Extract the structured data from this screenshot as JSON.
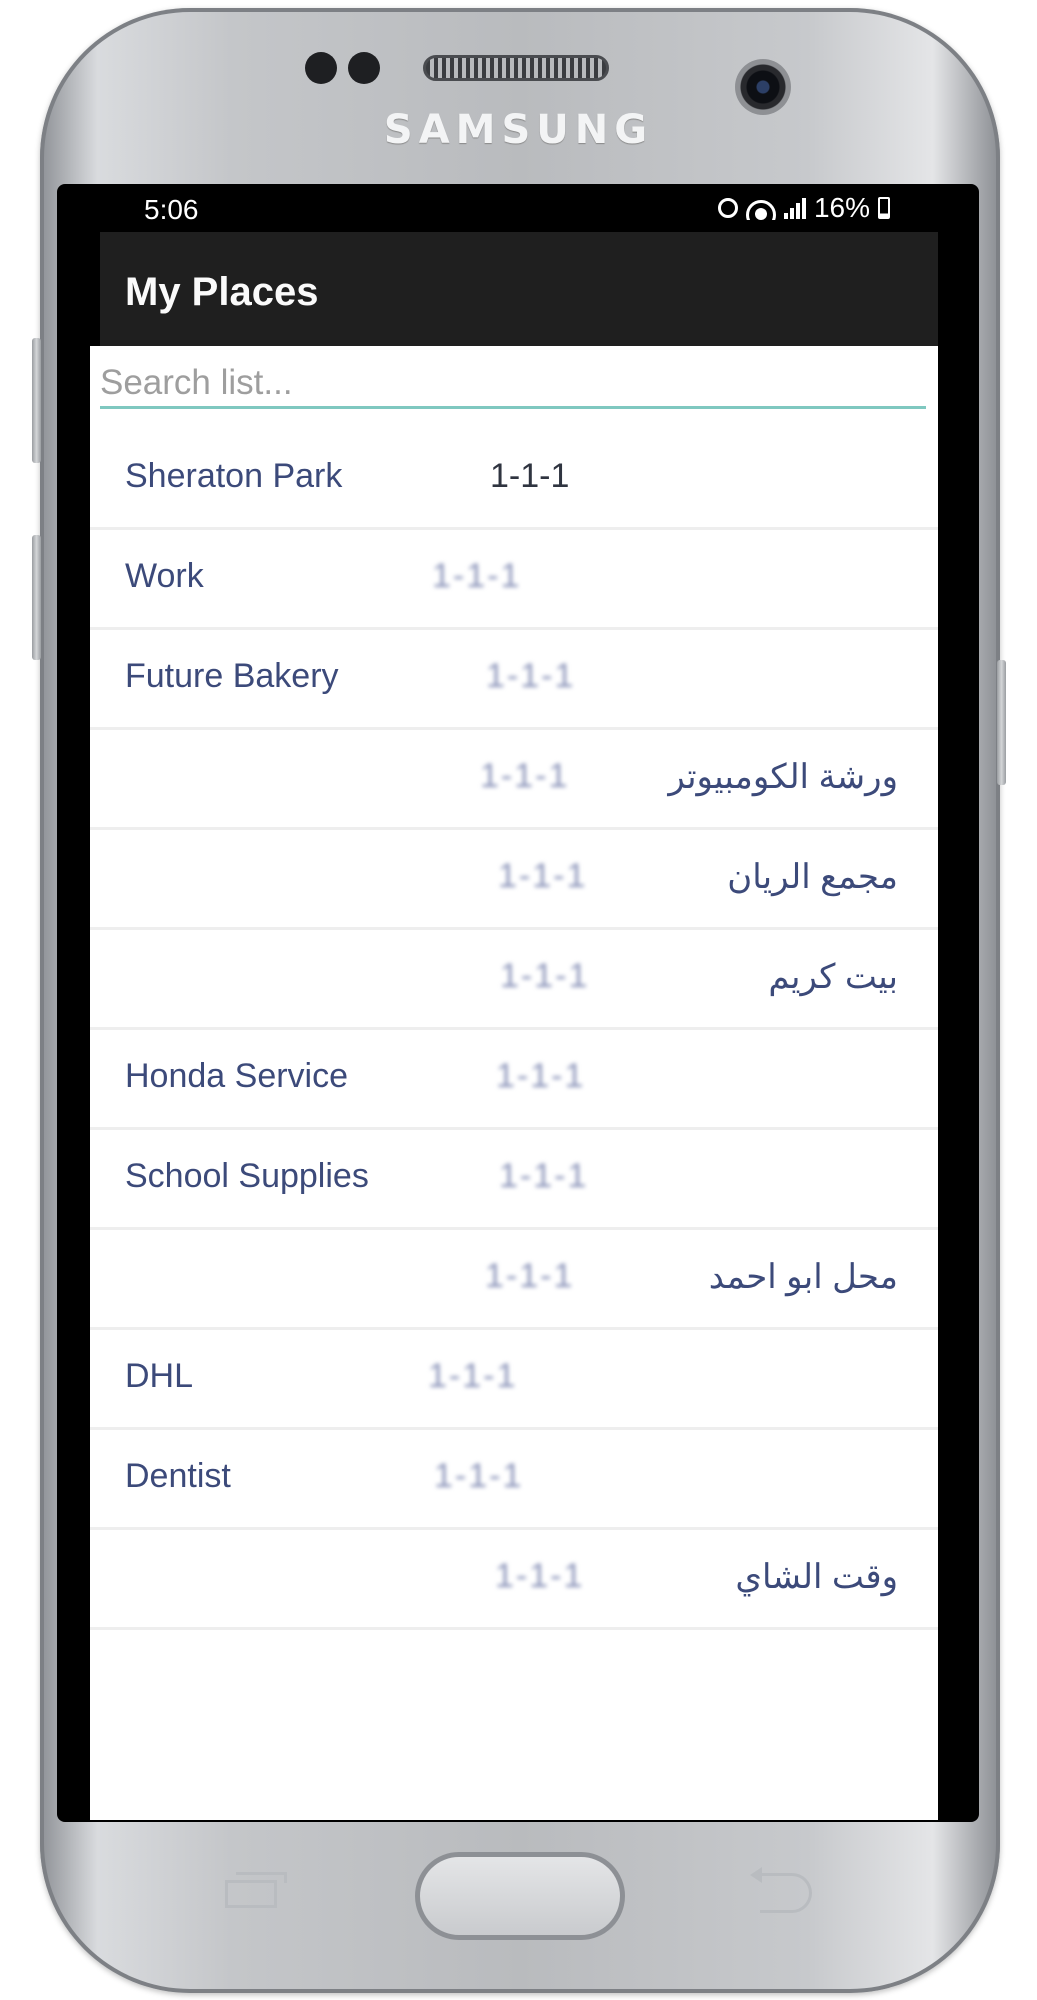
{
  "device": {
    "brand": "SAMSUNG"
  },
  "status_bar": {
    "time": "5:06",
    "battery": "16%"
  },
  "app_bar": {
    "title": "My Places"
  },
  "search": {
    "placeholder": "Search list..."
  },
  "places": [
    {
      "name": "Sheraton Park",
      "code": "1-1-1",
      "rtl": false
    },
    {
      "name": "Work",
      "code": "1-1-1",
      "rtl": false
    },
    {
      "name": "Future Bakery",
      "code": "1-1-1",
      "rtl": false
    },
    {
      "name": "ورشة الكومبيوتر",
      "code": "1-1-1",
      "rtl": true
    },
    {
      "name": "مجمع الريان",
      "code": "1-1-1",
      "rtl": true
    },
    {
      "name": "بيت كريم",
      "code": "1-1-1",
      "rtl": true
    },
    {
      "name": "Honda Service",
      "code": "1-1-1",
      "rtl": false
    },
    {
      "name": "School Supplies",
      "code": "1-1-1",
      "rtl": false
    },
    {
      "name": "محل ابو احمد",
      "code": "1-1-1",
      "rtl": true
    },
    {
      "name": "DHL",
      "code": "1-1-1",
      "rtl": false
    },
    {
      "name": "Dentist",
      "code": "1-1-1",
      "rtl": false
    },
    {
      "name": "وقت الشاي",
      "code": "1-1-1",
      "rtl": true
    }
  ]
}
